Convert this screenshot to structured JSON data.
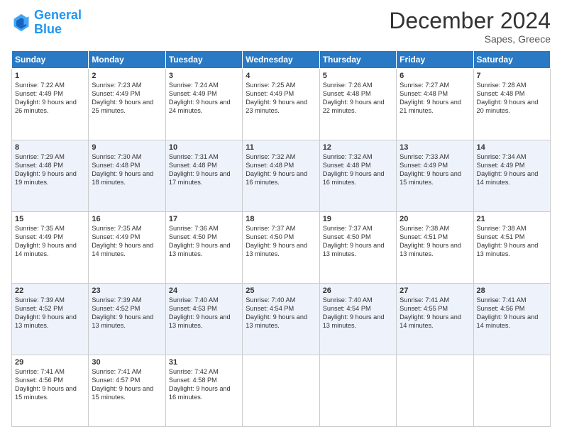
{
  "logo": {
    "line1": "General",
    "line2": "Blue"
  },
  "title": "December 2024",
  "subtitle": "Sapes, Greece",
  "days": [
    "Sunday",
    "Monday",
    "Tuesday",
    "Wednesday",
    "Thursday",
    "Friday",
    "Saturday"
  ],
  "weeks": [
    [
      {
        "day": 1,
        "sunrise": "7:22 AM",
        "sunset": "4:49 PM",
        "daylight": "9 hours and 26 minutes."
      },
      {
        "day": 2,
        "sunrise": "7:23 AM",
        "sunset": "4:49 PM",
        "daylight": "9 hours and 25 minutes."
      },
      {
        "day": 3,
        "sunrise": "7:24 AM",
        "sunset": "4:49 PM",
        "daylight": "9 hours and 24 minutes."
      },
      {
        "day": 4,
        "sunrise": "7:25 AM",
        "sunset": "4:49 PM",
        "daylight": "9 hours and 23 minutes."
      },
      {
        "day": 5,
        "sunrise": "7:26 AM",
        "sunset": "4:48 PM",
        "daylight": "9 hours and 22 minutes."
      },
      {
        "day": 6,
        "sunrise": "7:27 AM",
        "sunset": "4:48 PM",
        "daylight": "9 hours and 21 minutes."
      },
      {
        "day": 7,
        "sunrise": "7:28 AM",
        "sunset": "4:48 PM",
        "daylight": "9 hours and 20 minutes."
      }
    ],
    [
      {
        "day": 8,
        "sunrise": "7:29 AM",
        "sunset": "4:48 PM",
        "daylight": "9 hours and 19 minutes."
      },
      {
        "day": 9,
        "sunrise": "7:30 AM",
        "sunset": "4:48 PM",
        "daylight": "9 hours and 18 minutes."
      },
      {
        "day": 10,
        "sunrise": "7:31 AM",
        "sunset": "4:48 PM",
        "daylight": "9 hours and 17 minutes."
      },
      {
        "day": 11,
        "sunrise": "7:32 AM",
        "sunset": "4:48 PM",
        "daylight": "9 hours and 16 minutes."
      },
      {
        "day": 12,
        "sunrise": "7:32 AM",
        "sunset": "4:48 PM",
        "daylight": "9 hours and 16 minutes."
      },
      {
        "day": 13,
        "sunrise": "7:33 AM",
        "sunset": "4:49 PM",
        "daylight": "9 hours and 15 minutes."
      },
      {
        "day": 14,
        "sunrise": "7:34 AM",
        "sunset": "4:49 PM",
        "daylight": "9 hours and 14 minutes."
      }
    ],
    [
      {
        "day": 15,
        "sunrise": "7:35 AM",
        "sunset": "4:49 PM",
        "daylight": "9 hours and 14 minutes."
      },
      {
        "day": 16,
        "sunrise": "7:35 AM",
        "sunset": "4:49 PM",
        "daylight": "9 hours and 14 minutes."
      },
      {
        "day": 17,
        "sunrise": "7:36 AM",
        "sunset": "4:50 PM",
        "daylight": "9 hours and 13 minutes."
      },
      {
        "day": 18,
        "sunrise": "7:37 AM",
        "sunset": "4:50 PM",
        "daylight": "9 hours and 13 minutes."
      },
      {
        "day": 19,
        "sunrise": "7:37 AM",
        "sunset": "4:50 PM",
        "daylight": "9 hours and 13 minutes."
      },
      {
        "day": 20,
        "sunrise": "7:38 AM",
        "sunset": "4:51 PM",
        "daylight": "9 hours and 13 minutes."
      },
      {
        "day": 21,
        "sunrise": "7:38 AM",
        "sunset": "4:51 PM",
        "daylight": "9 hours and 13 minutes."
      }
    ],
    [
      {
        "day": 22,
        "sunrise": "7:39 AM",
        "sunset": "4:52 PM",
        "daylight": "9 hours and 13 minutes."
      },
      {
        "day": 23,
        "sunrise": "7:39 AM",
        "sunset": "4:52 PM",
        "daylight": "9 hours and 13 minutes."
      },
      {
        "day": 24,
        "sunrise": "7:40 AM",
        "sunset": "4:53 PM",
        "daylight": "9 hours and 13 minutes."
      },
      {
        "day": 25,
        "sunrise": "7:40 AM",
        "sunset": "4:54 PM",
        "daylight": "9 hours and 13 minutes."
      },
      {
        "day": 26,
        "sunrise": "7:40 AM",
        "sunset": "4:54 PM",
        "daylight": "9 hours and 13 minutes."
      },
      {
        "day": 27,
        "sunrise": "7:41 AM",
        "sunset": "4:55 PM",
        "daylight": "9 hours and 14 minutes."
      },
      {
        "day": 28,
        "sunrise": "7:41 AM",
        "sunset": "4:56 PM",
        "daylight": "9 hours and 14 minutes."
      }
    ],
    [
      {
        "day": 29,
        "sunrise": "7:41 AM",
        "sunset": "4:56 PM",
        "daylight": "9 hours and 15 minutes."
      },
      {
        "day": 30,
        "sunrise": "7:41 AM",
        "sunset": "4:57 PM",
        "daylight": "9 hours and 15 minutes."
      },
      {
        "day": 31,
        "sunrise": "7:42 AM",
        "sunset": "4:58 PM",
        "daylight": "9 hours and 16 minutes."
      },
      null,
      null,
      null,
      null
    ]
  ]
}
